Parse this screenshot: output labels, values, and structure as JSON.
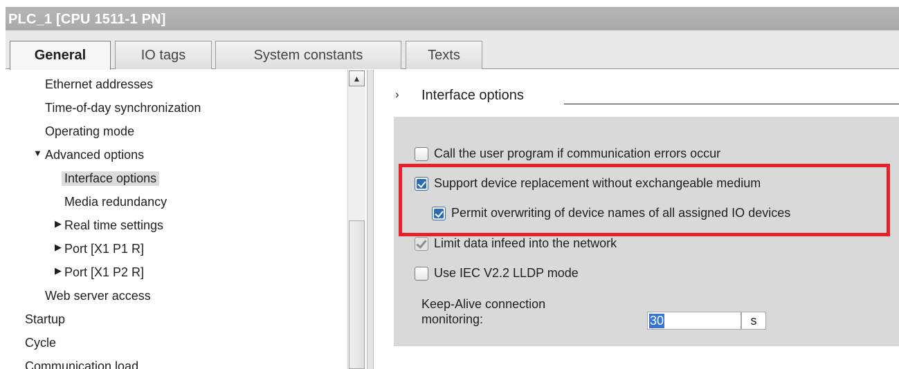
{
  "window": {
    "title": "PLC_1 [CPU 1511-1 PN]"
  },
  "tabs": [
    {
      "label": "General",
      "active": true
    },
    {
      "label": "IO tags",
      "active": false
    },
    {
      "label": "System constants",
      "active": false
    },
    {
      "label": "Texts",
      "active": false
    }
  ],
  "nav": {
    "items": [
      {
        "label": "Ethernet addresses"
      },
      {
        "label": "Time-of-day synchronization"
      },
      {
        "label": "Operating mode"
      },
      {
        "label": "Advanced options",
        "expanded": true
      },
      {
        "label": "Interface options",
        "selected": true
      },
      {
        "label": "Media redundancy"
      },
      {
        "label": "Real time settings",
        "expanded": false
      },
      {
        "label": "Port [X1 P1 R]",
        "expanded": false
      },
      {
        "label": "Port [X1 P2 R]",
        "expanded": false
      },
      {
        "label": "Web server access"
      },
      {
        "label": "Startup"
      },
      {
        "label": "Cycle"
      },
      {
        "label": "Communication load"
      }
    ]
  },
  "section": {
    "chevron": "›",
    "title": "Interface options"
  },
  "options": [
    {
      "label": "Call the user program if communication errors occur",
      "checked": false
    },
    {
      "label": "Support device replacement without exchangeable medium",
      "checked": true
    },
    {
      "label": "Permit overwriting of device names of all assigned IO devices",
      "checked": true
    },
    {
      "label": "Limit data infeed into the network",
      "checked": true,
      "disabled": true
    },
    {
      "label": "Use IEC V2.2 LLDP mode",
      "checked": false
    }
  ],
  "keep_alive": {
    "label_line1": "Keep-Alive connection",
    "label_line2": "monitoring:",
    "value": "30",
    "unit": "s"
  },
  "icons": {
    "scroll_up": "▲",
    "expanded": "▼",
    "collapsed": "▶"
  },
  "colors": {
    "highlight": "#e8202a",
    "checkbox_checked": "#2b6cb0",
    "selection": "#3874d8"
  }
}
